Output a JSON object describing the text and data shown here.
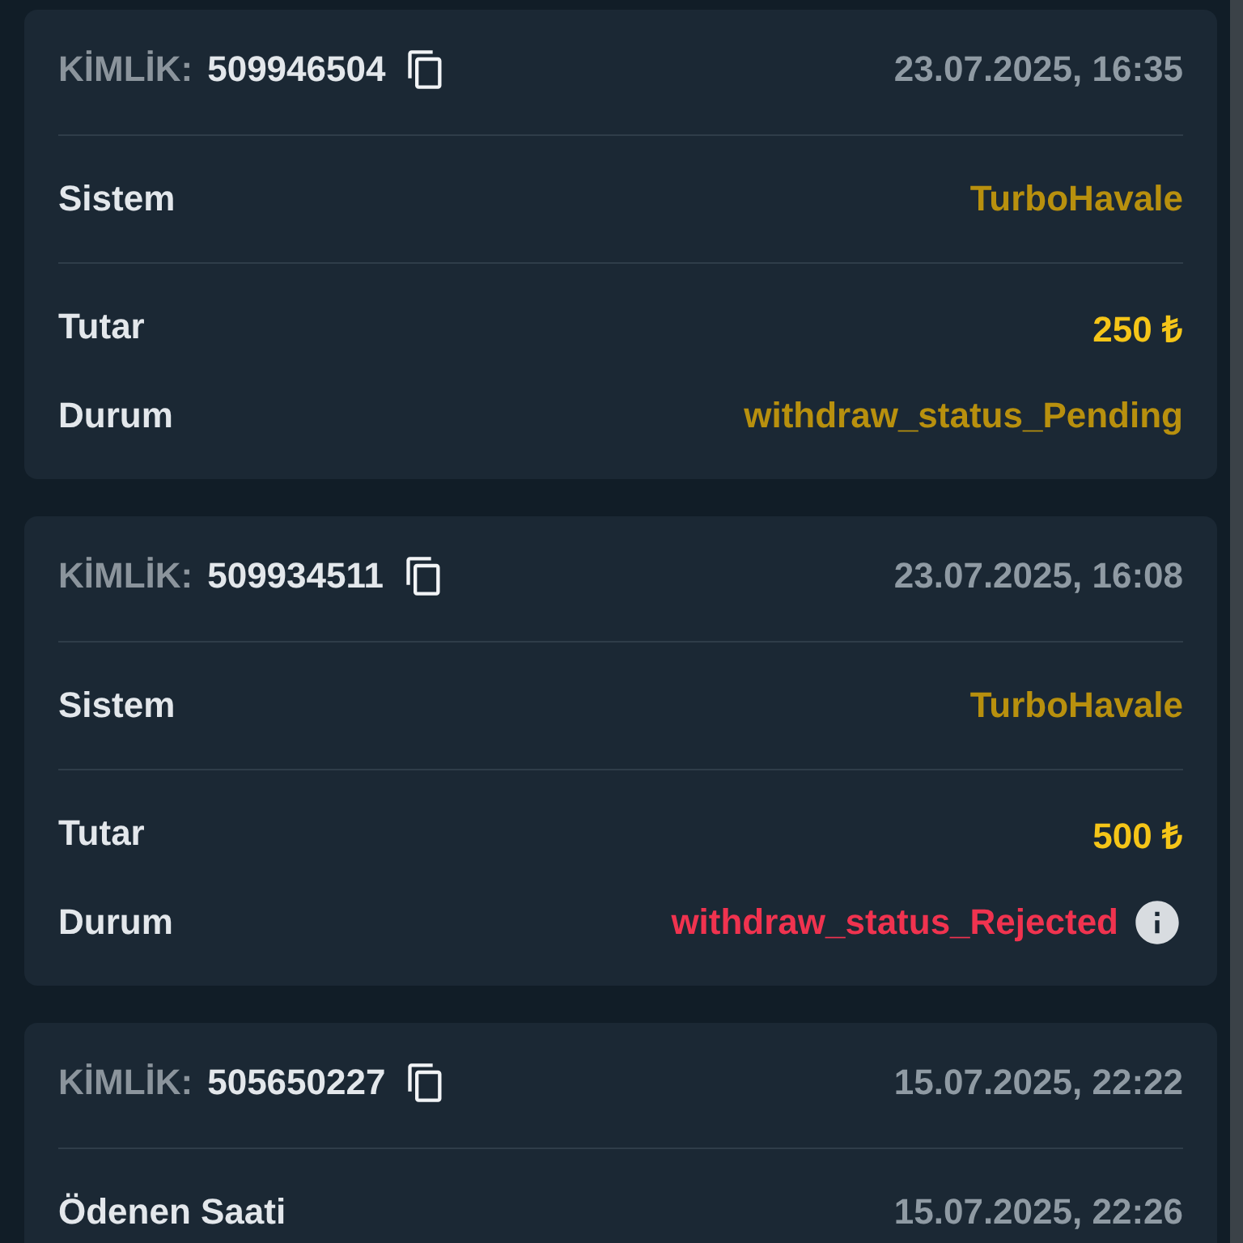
{
  "cards": [
    {
      "id_label": "KİMLİK:",
      "id": "509946504",
      "date": "23.07.2025, 16:35",
      "groups": [
        {
          "rows": [
            {
              "label": "Sistem",
              "value": "TurboHavale",
              "kind": "system"
            }
          ]
        },
        {
          "rows": [
            {
              "label": "Tutar",
              "value": "250 ₺",
              "kind": "amount"
            },
            {
              "label": "Durum",
              "value": "withdraw_status_Pending",
              "kind": "status",
              "color": "#b8900e",
              "info": false
            }
          ]
        }
      ]
    },
    {
      "id_label": "KİMLİK:",
      "id": "509934511",
      "date": "23.07.2025, 16:08",
      "groups": [
        {
          "rows": [
            {
              "label": "Sistem",
              "value": "TurboHavale",
              "kind": "system"
            }
          ]
        },
        {
          "rows": [
            {
              "label": "Tutar",
              "value": "500 ₺",
              "kind": "amount"
            },
            {
              "label": "Durum",
              "value": "withdraw_status_Rejected",
              "kind": "status",
              "color": "#f0334f",
              "info": true
            }
          ]
        }
      ]
    },
    {
      "id_label": "KİMLİK:",
      "id": "505650227",
      "date": "15.07.2025, 22:22",
      "groups": [
        {
          "rows": [
            {
              "label": "Ödenen Saati",
              "value": "15.07.2025, 22:26",
              "kind": "time"
            }
          ]
        }
      ]
    }
  ]
}
